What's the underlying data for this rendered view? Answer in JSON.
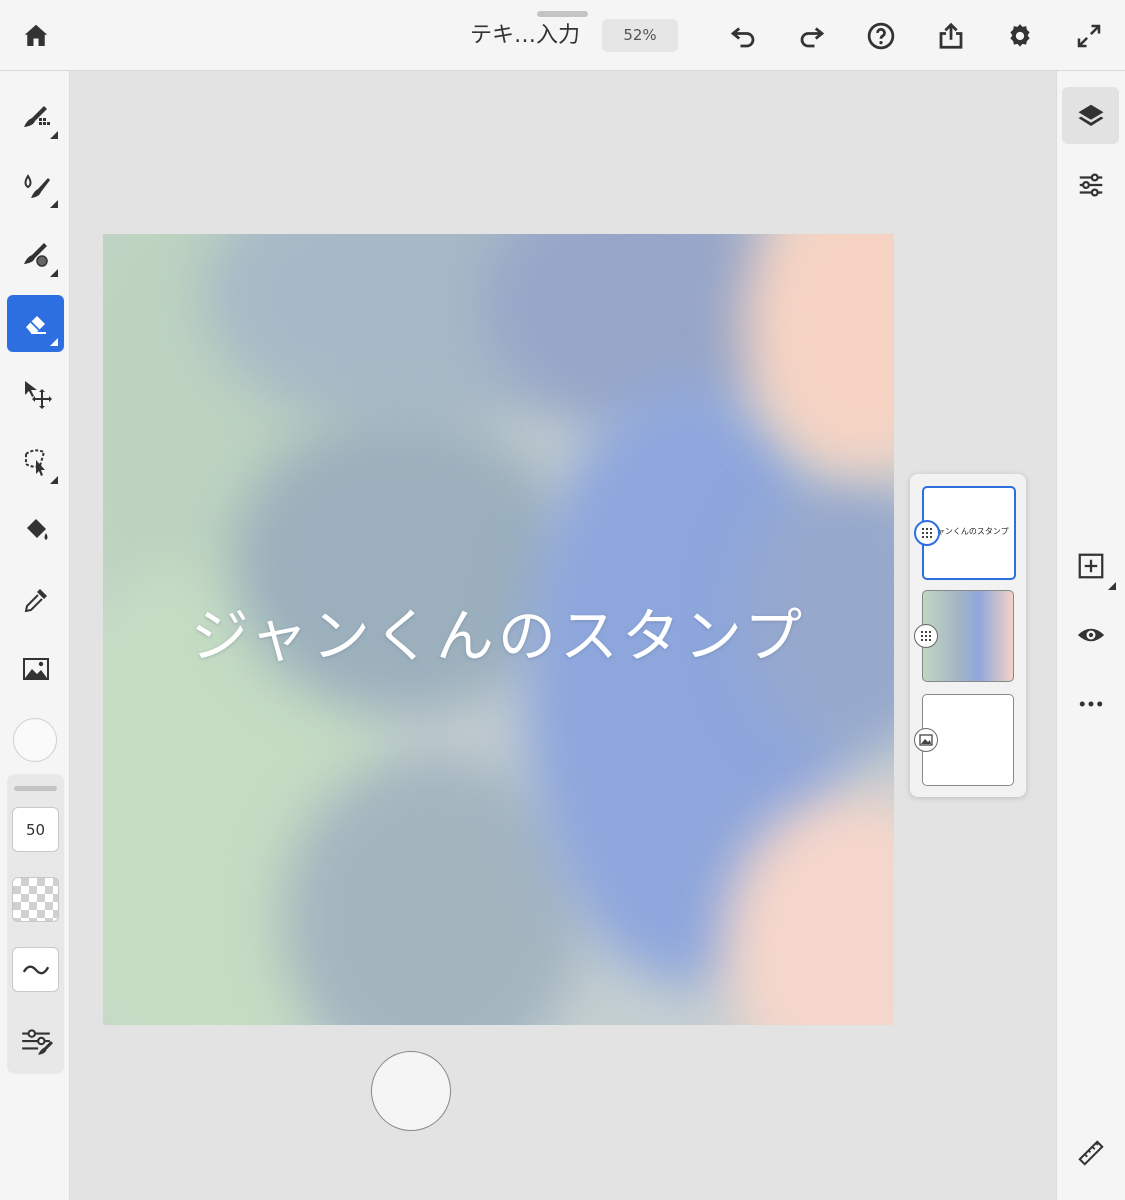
{
  "header": {
    "document_title": "テキ…入力",
    "zoom": "52%",
    "icons": [
      "home-icon",
      "undo-icon",
      "redo-icon",
      "help-icon",
      "share-icon",
      "settings-icon",
      "fullscreen-icon"
    ]
  },
  "toolbar": {
    "tools": [
      "pixel-brush-icon",
      "live-brush-icon",
      "vector-brush-icon",
      "eraser-icon",
      "move-transform-icon",
      "lasso-select-icon",
      "fill-bucket-icon",
      "eyedropper-icon",
      "image-place-icon"
    ],
    "active_tool": "eraser-icon",
    "current_color": "#fafafa",
    "brush_size": "50"
  },
  "canvas": {
    "text": "ジャンくんのスタンプ",
    "palette": {
      "green": "#bfd8bf",
      "blue": "#8ea6dc",
      "slate": "#9fb0bf",
      "peach": "#f6d3c3"
    }
  },
  "layers": {
    "items": [
      {
        "name": "text-layer",
        "thumb_text": "ジャンくんのスタンプ",
        "selected": true
      },
      {
        "name": "paint-layer",
        "selected": false
      },
      {
        "name": "background-layer",
        "selected": false
      }
    ]
  },
  "right_toolbar": {
    "icons": [
      "layers-icon",
      "adjustments-icon",
      "add-layer-icon",
      "visibility-icon",
      "more-icon",
      "ruler-icon"
    ]
  },
  "theme": {
    "accent": "#2d6fe0"
  }
}
